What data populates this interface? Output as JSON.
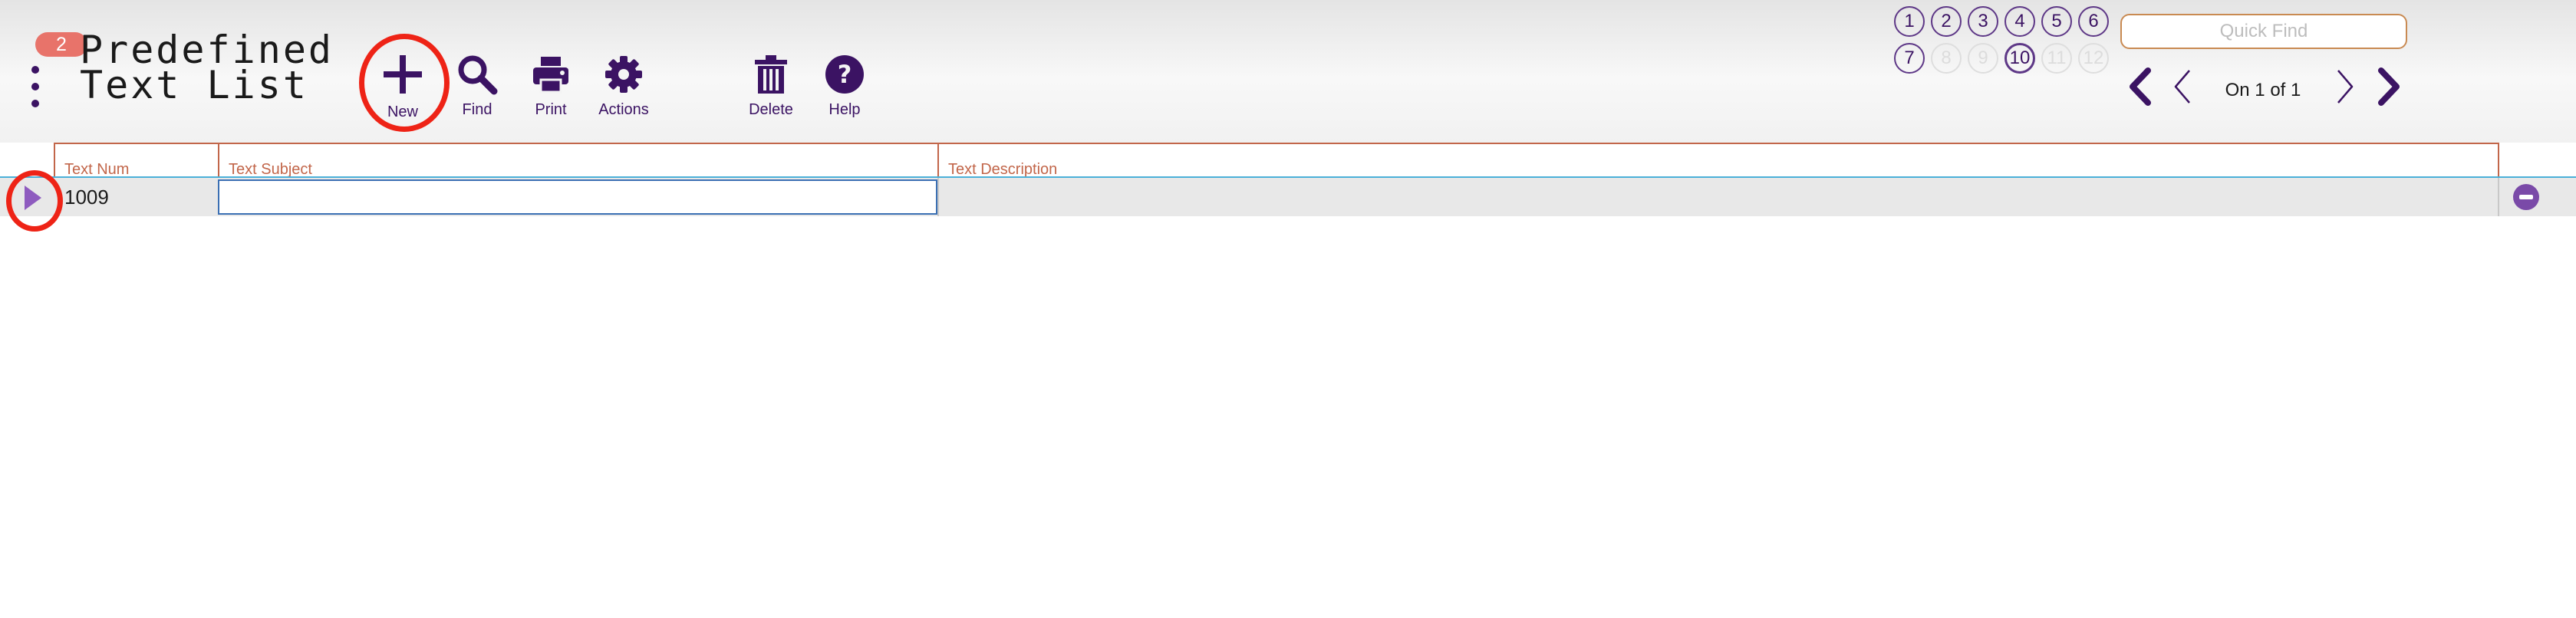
{
  "header": {
    "badge": "2",
    "title_line1": "Predefined",
    "title_line2": "Text List"
  },
  "toolbar": {
    "new_label": "New",
    "find_label": "Find",
    "print_label": "Print",
    "actions_label": "Actions",
    "delete_label": "Delete",
    "help_label": "Help"
  },
  "pages": {
    "p1": "1",
    "p2": "2",
    "p3": "3",
    "p4": "4",
    "p5": "5",
    "p6": "6",
    "p7": "7",
    "p8": "8",
    "p9": "9",
    "p10": "10",
    "p11": "11",
    "p12": "12",
    "current": "10",
    "disabled": [
      "8",
      "9",
      "11",
      "12"
    ]
  },
  "search": {
    "placeholder": "Quick Find",
    "value": ""
  },
  "navigation": {
    "record_info": "On 1 of 1"
  },
  "table": {
    "columns": [
      "Text Num",
      "Text Subject",
      "Text Description"
    ],
    "rows": [
      {
        "num": "1009",
        "subject": "",
        "description": ""
      }
    ]
  },
  "colors": {
    "accent": "#3b1363",
    "highlight_ring": "#ee2316",
    "header_line": "#c2664a",
    "badge": "#e8736a",
    "row_arrow": "#8e5bbf"
  },
  "icons": [
    "menu-dots-icon",
    "plus-icon",
    "search-icon",
    "printer-icon",
    "gear-icon",
    "trash-icon",
    "help-icon",
    "first-record-icon",
    "previous-record-icon",
    "next-record-icon",
    "last-record-icon",
    "row-select-arrow-icon",
    "minus-circle-icon"
  ]
}
